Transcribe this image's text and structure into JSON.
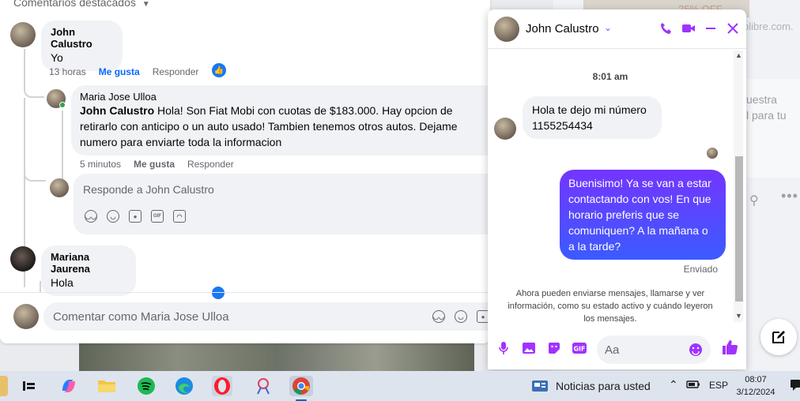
{
  "comments": {
    "header": "Comentarios destacados",
    "items": [
      {
        "name": "John Calustro",
        "text": "Yo",
        "time": "13 horas",
        "like": "Me gusta",
        "reply": "Responder"
      },
      {
        "name": "Maria Jose Ulloa",
        "mention": "John Calustro",
        "text": " Hola! Son Fiat Mobi con cuotas de $183.000. Hay opcion de retirarlo con anticipo o un auto usado! Tambien tenemos otros autos. Dejame numero para enviarte toda la informacion",
        "time": "5 minutos",
        "like": "Me gusta",
        "reply": "Responder"
      },
      {
        "name": "Mariana Jaurena",
        "text": "Hola"
      }
    ],
    "reply_placeholder": "Responde a John Calustro",
    "comment_placeholder": "Comentar como Maria Jose Ulloa",
    "reply_tools": [
      "sticker-icon",
      "emoji-icon",
      "camera-icon",
      "gif-icon",
      "avatar-sticker-icon"
    ]
  },
  "chat": {
    "contact_name": "John Calustro",
    "timestamp": "8:01 am",
    "incoming": "Hola te dejo mi número 1155254434",
    "outgoing": "Buenisimo! Ya se van a estar contactando con vos! En que horario preferis que se comuniquen? A la mañana o a la tarde?",
    "status": "Enviado",
    "info": "Ahora pueden enviarse mensajes, llamarse y ver información, como su estado activo y cuándo leyeron los mensajes.",
    "input_placeholder": "Aa",
    "accent_color": "#a033ff"
  },
  "background": {
    "ad_text": "25% OFF",
    "url_text": "plibre.com.",
    "text1": "uestra",
    "text2": "l para tu"
  },
  "taskbar": {
    "news": "Noticias para usted",
    "lang": "ESP",
    "time": "08:07",
    "date": "3/12/2024"
  }
}
